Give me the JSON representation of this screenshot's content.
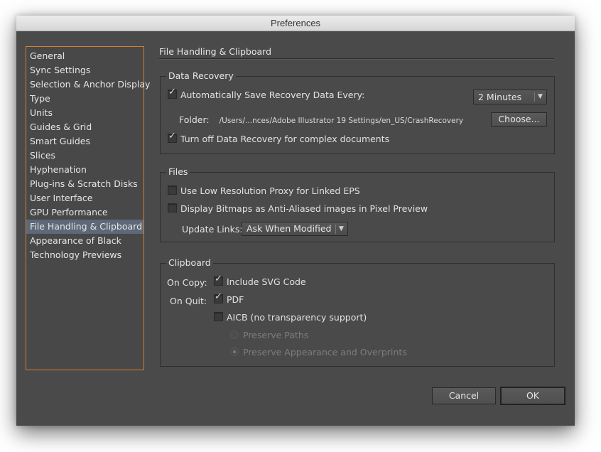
{
  "window": {
    "title": "Preferences"
  },
  "sidebar": {
    "items": [
      {
        "label": "General"
      },
      {
        "label": "Sync Settings"
      },
      {
        "label": "Selection & Anchor Display"
      },
      {
        "label": "Type"
      },
      {
        "label": "Units"
      },
      {
        "label": "Guides & Grid"
      },
      {
        "label": "Smart Guides"
      },
      {
        "label": "Slices"
      },
      {
        "label": "Hyphenation"
      },
      {
        "label": "Plug-ins & Scratch Disks"
      },
      {
        "label": "User Interface"
      },
      {
        "label": "GPU Performance"
      },
      {
        "label": "File Handling & Clipboard",
        "selected": true
      },
      {
        "label": "Appearance of Black"
      },
      {
        "label": "Technology Previews"
      }
    ],
    "selected_color": "#5d6878",
    "border_color": "#d8812e"
  },
  "main": {
    "title": "File Handling & Clipboard",
    "data_recovery": {
      "legend": "Data Recovery",
      "auto_save": {
        "label": "Automatically Save Recovery Data Every:",
        "checked": true
      },
      "interval": {
        "value": "2 Minutes"
      },
      "folder_label": "Folder:",
      "folder_path": "/Users/...nces/Adobe Illustrator 19 Settings/en_US/CrashRecovery",
      "choose_button": "Choose...",
      "turn_off": {
        "label": "Turn off Data Recovery for complex documents",
        "checked": true
      }
    },
    "files": {
      "legend": "Files",
      "low_res_proxy": {
        "label": "Use Low Resolution Proxy for Linked EPS",
        "checked": false
      },
      "anti_aliased": {
        "label": "Display Bitmaps as Anti-Aliased images in Pixel Preview",
        "checked": false
      },
      "update_links_label": "Update Links:",
      "update_links_value": "Ask When Modified"
    },
    "clipboard": {
      "legend": "Clipboard",
      "on_copy_label": "On Copy:",
      "include_svg": {
        "label": "Include SVG Code",
        "checked": true
      },
      "on_quit_label": "On Quit:",
      "pdf": {
        "label": "PDF",
        "checked": true
      },
      "aicb": {
        "label": "AICB (no transparency support)",
        "checked": false
      },
      "preserve_paths": {
        "label": "Preserve Paths",
        "selected": false,
        "disabled": true
      },
      "preserve_appearance": {
        "label": "Preserve Appearance and Overprints",
        "selected": true,
        "disabled": true
      }
    }
  },
  "footer": {
    "cancel": "Cancel",
    "ok": "OK"
  },
  "icons": {
    "checkmark": "✓",
    "dropdown_arrow": "▼"
  }
}
